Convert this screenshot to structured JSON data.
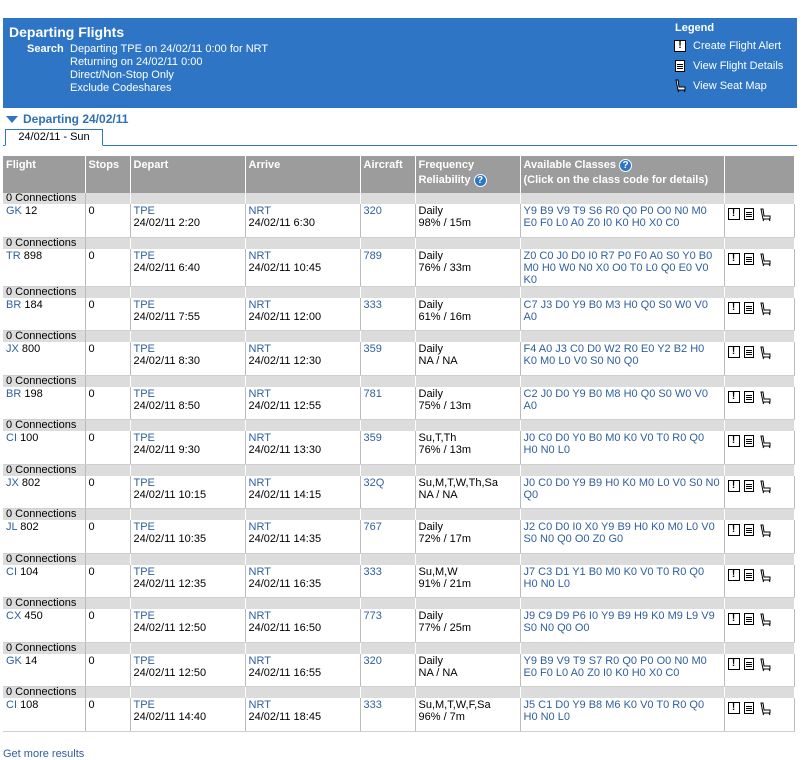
{
  "header": {
    "title": "Departing Flights",
    "search_label": "Search",
    "search_lines": [
      "Departing TPE on 24/02/11 0:00 for NRT",
      "Returning on 24/02/11 0:00",
      "Direct/Non-Stop Only",
      "Exclude Codeshares"
    ]
  },
  "legend": {
    "title": "Legend",
    "items": [
      {
        "label": "Create Flight Alert",
        "icon": "alert-icon"
      },
      {
        "label": "View Flight Details",
        "icon": "details-icon"
      },
      {
        "label": "View Seat Map",
        "icon": "seat-icon"
      }
    ]
  },
  "departing_link": "Departing 24/02/11",
  "tab": "24/02/11 - Sun",
  "columns": {
    "flight": "Flight",
    "stops": "Stops",
    "depart": "Depart",
    "arrive": "Arrive",
    "aircraft": "Aircraft",
    "frequency": "Frequency",
    "reliability": "Reliability",
    "classes": "Available Classes",
    "classes_note": "(Click on the class code for details)"
  },
  "flights": [
    {
      "conn": "0 Connections",
      "airline": "GK",
      "num": "12",
      "stops": "0",
      "dep_code": "TPE",
      "dep_time": "24/02/11 2:20",
      "arr_code": "NRT",
      "arr_time": "24/02/11 6:30",
      "aircraft": "320",
      "freq": "Daily",
      "rel": "98% / 15m",
      "classes": "Y9 B9 V9 T9 S6 R0 Q0 P0 O0 N0 M0 E0 F0 L0 A0 Z0 I0 K0 H0 X0 C0"
    },
    {
      "conn": "0 Connections",
      "airline": "TR",
      "num": "898",
      "stops": "0",
      "dep_code": "TPE",
      "dep_time": "24/02/11 6:40",
      "arr_code": "NRT",
      "arr_time": "24/02/11 10:45",
      "aircraft": "789",
      "freq": "Daily",
      "rel": "76% / 33m",
      "classes": "Z0 C0 J0 D0 I0 R7 P0 F0 A0 S0 Y0 B0 M0 H0 W0 N0 X0 O0 T0 L0 Q0 E0 V0 K0"
    },
    {
      "conn": "0 Connections",
      "airline": "BR",
      "num": "184",
      "stops": "0",
      "dep_code": "TPE",
      "dep_time": "24/02/11 7:55",
      "arr_code": "NRT",
      "arr_time": "24/02/11 12:00",
      "aircraft": "333",
      "freq": "Daily",
      "rel": "61% / 16m",
      "classes": "C7 J3 D0 Y9 B0 M3 H0 Q0 S0 W0 V0 A0"
    },
    {
      "conn": "0 Connections",
      "airline": "JX",
      "num": "800",
      "stops": "0",
      "dep_code": "TPE",
      "dep_time": "24/02/11 8:30",
      "arr_code": "NRT",
      "arr_time": "24/02/11 12:30",
      "aircraft": "359",
      "freq": "Daily",
      "rel": "NA / NA",
      "classes": "F4 A0 J3 C0 D0 W2 R0 E0 Y2 B2 H0 K0 M0 L0 V0 S0 N0 Q0"
    },
    {
      "conn": "0 Connections",
      "airline": "BR",
      "num": "198",
      "stops": "0",
      "dep_code": "TPE",
      "dep_time": "24/02/11 8:50",
      "arr_code": "NRT",
      "arr_time": "24/02/11 12:55",
      "aircraft": "781",
      "freq": "Daily",
      "rel": "75% / 13m",
      "classes": "C2 J0 D0 Y9 B0 M8 H0 Q0 S0 W0 V0 A0"
    },
    {
      "conn": "0 Connections",
      "airline": "CI",
      "num": "100",
      "stops": "0",
      "dep_code": "TPE",
      "dep_time": "24/02/11 9:30",
      "arr_code": "NRT",
      "arr_time": "24/02/11 13:30",
      "aircraft": "359",
      "freq": "Su,T,Th",
      "rel": "76% / 13m",
      "classes": "J0 C0 D0 Y0 B0 M0 K0 V0 T0 R0 Q0 H0 N0 L0"
    },
    {
      "conn": "0 Connections",
      "airline": "JX",
      "num": "802",
      "stops": "0",
      "dep_code": "TPE",
      "dep_time": "24/02/11 10:15",
      "arr_code": "NRT",
      "arr_time": "24/02/11 14:15",
      "aircraft": "32Q",
      "freq": "Su,M,T,W,Th,Sa",
      "rel": "NA / NA",
      "classes": "J0 C0 D0 Y9 B9 H0 K0 M0 L0 V0 S0 N0 Q0"
    },
    {
      "conn": "0 Connections",
      "airline": "JL",
      "num": "802",
      "stops": "0",
      "dep_code": "TPE",
      "dep_time": "24/02/11 10:35",
      "arr_code": "NRT",
      "arr_time": "24/02/11 14:35",
      "aircraft": "767",
      "freq": "Daily",
      "rel": "72% / 17m",
      "classes": "J2 C0 D0 I0 X0 Y9 B9 H0 K0 M0 L0 V0 S0 N0 Q0 O0 Z0 G0"
    },
    {
      "conn": "0 Connections",
      "airline": "CI",
      "num": "104",
      "stops": "0",
      "dep_code": "TPE",
      "dep_time": "24/02/11 12:35",
      "arr_code": "NRT",
      "arr_time": "24/02/11 16:35",
      "aircraft": "333",
      "freq": "Su,M,W",
      "rel": "91% / 21m",
      "classes": "J7 C3 D1 Y1 B0 M0 K0 V0 T0 R0 Q0 H0 N0 L0"
    },
    {
      "conn": "0 Connections",
      "airline": "CX",
      "num": "450",
      "stops": "0",
      "dep_code": "TPE",
      "dep_time": "24/02/11 12:50",
      "arr_code": "NRT",
      "arr_time": "24/02/11 16:50",
      "aircraft": "773",
      "freq": "Daily",
      "rel": "77% / 25m",
      "classes": "J9 C9 D9 P6 I0 Y9 B9 H9 K0 M9 L9 V9 S0 N0 Q0 O0"
    },
    {
      "conn": "0 Connections",
      "airline": "GK",
      "num": "14",
      "stops": "0",
      "dep_code": "TPE",
      "dep_time": "24/02/11 12:50",
      "arr_code": "NRT",
      "arr_time": "24/02/11 16:55",
      "aircraft": "320",
      "freq": "Daily",
      "rel": "NA / NA",
      "classes": "Y9 B9 V9 T9 S7 R0 Q0 P0 O0 N0 M0 E0 F0 L0 A0 Z0 I0 K0 H0 X0 C0"
    },
    {
      "conn": "0 Connections",
      "airline": "CI",
      "num": "108",
      "stops": "0",
      "dep_code": "TPE",
      "dep_time": "24/02/11 14:40",
      "arr_code": "NRT",
      "arr_time": "24/02/11 18:45",
      "aircraft": "333",
      "freq": "Su,M,T,W,F,Sa",
      "rel": "96% / 7m",
      "classes": "J5 C1 D0 Y9 B8 M6 K0 V0 T0 R0 Q0 H0 N0 L0"
    }
  ],
  "more_results": "Get more results"
}
